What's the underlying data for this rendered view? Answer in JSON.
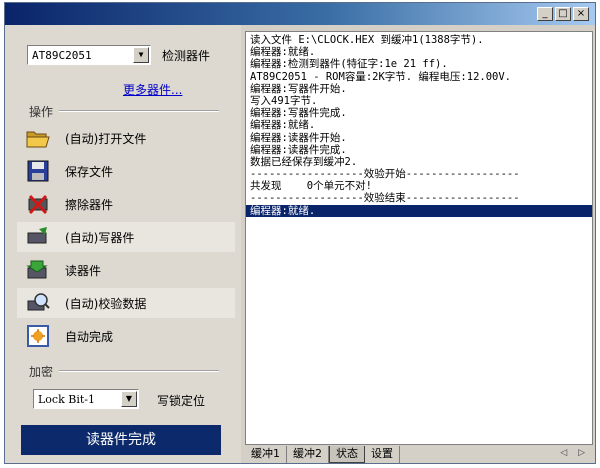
{
  "window": {
    "title": "",
    "buttons": [
      "_",
      "□",
      "×"
    ]
  },
  "left": {
    "device": {
      "value": "AT89C2051",
      "arrow": "▼"
    },
    "detect_label": "检测器件",
    "more_devices": "更多器件...",
    "operations_section": "操作",
    "actions": [
      {
        "label": "(自动)打开文件",
        "icon": "open-folder-icon",
        "highlight": true
      },
      {
        "label": "保存文件",
        "icon": "save-disk-icon",
        "highlight": false
      },
      {
        "label": "擦除器件",
        "icon": "erase-chip-icon",
        "highlight": false
      },
      {
        "label": "(自动)写器件",
        "icon": "write-chip-icon",
        "highlight": true
      },
      {
        "label": "读器件",
        "icon": "read-chip-icon",
        "highlight": false
      },
      {
        "label": "(自动)校验数据",
        "icon": "verify-chip-icon",
        "highlight": true
      },
      {
        "label": "自动完成",
        "icon": "auto-complete-icon",
        "highlight": false
      }
    ],
    "encrypt_section": "加密",
    "lock": {
      "value": "Lock Bit-1",
      "arrow": "▼"
    },
    "lock_label": "写锁定位",
    "status_button": "读器件完成"
  },
  "log": {
    "lines": [
      "读入文件 E:\\CLOCK.HEX 到缓冲1(1388字节).",
      "编程器:就绪.",
      "编程器:检测到器件(特征字:1e 21 ff).",
      "AT89C2051 - ROM容量:2K字节. 编程电压:12.00V.",
      "编程器:写器件开始.",
      "写入491字节.",
      "编程器:写器件完成.",
      "编程器:就绪.",
      "编程器:读器件开始.",
      "编程器:读器件完成.",
      "数据已经保存到缓冲2.",
      "------------------效验开始------------------",
      "共发现    0个单元不对!",
      "------------------效验结束------------------",
      "编程器:就绪."
    ],
    "selected_index": 14
  },
  "tabs": [
    "缓冲1",
    "缓冲2",
    "状态",
    "设置"
  ],
  "active_tab": 2,
  "scroll_arrows": "◁ ▷"
}
